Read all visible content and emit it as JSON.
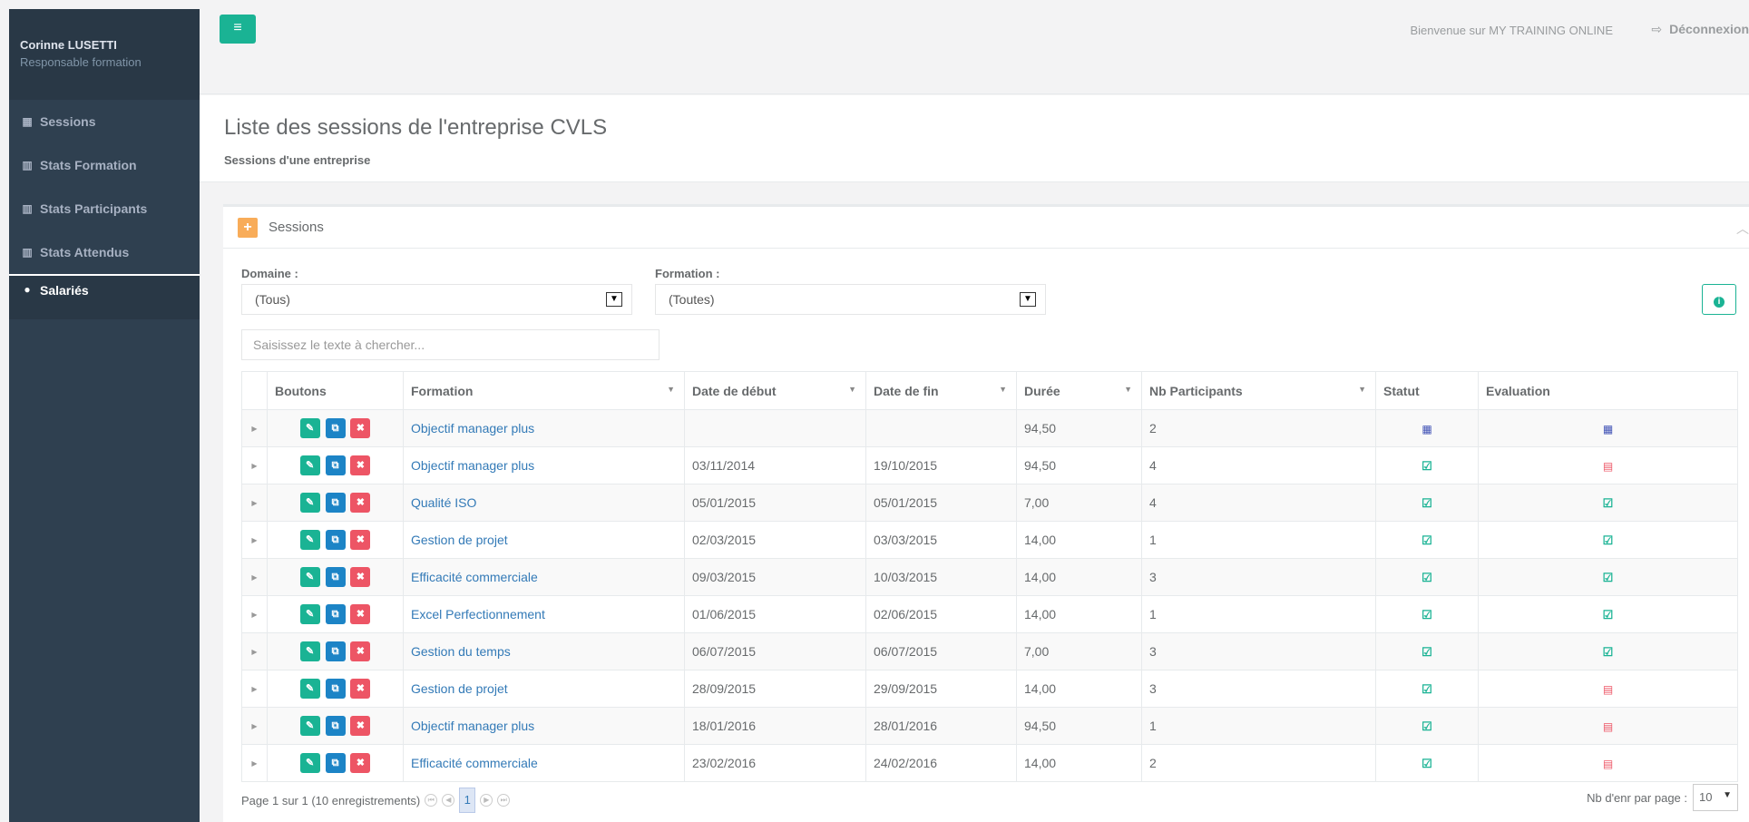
{
  "user": {
    "name": "Corinne LUSETTI",
    "role": "Responsable formation"
  },
  "sidebar": {
    "items": [
      {
        "label": "Sessions",
        "icon": "calendar-icon"
      },
      {
        "label": "Stats Formation",
        "icon": "bar-chart-icon"
      },
      {
        "label": "Stats Participants",
        "icon": "bar-chart-icon"
      },
      {
        "label": "Stats Attendus",
        "icon": "bar-chart-icon"
      },
      {
        "label": "Salariés",
        "icon": "user-icon"
      }
    ]
  },
  "topbar": {
    "welcome": "Bienvenue sur MY TRAINING ONLINE",
    "logout_label": "Déconnexion"
  },
  "heading": {
    "title": "Liste des sessions de l'entreprise CVLS",
    "subtitle": "Sessions d'une entreprise"
  },
  "panel": {
    "title": "Sessions",
    "domaine_label": "Domaine :",
    "domaine_value": "(Tous)",
    "formation_label": "Formation :",
    "formation_value": "(Toutes)",
    "search_placeholder": "Saisissez le texte à chercher..."
  },
  "table": {
    "columns": [
      "Boutons",
      "Formation",
      "Date de début",
      "Date de fin",
      "Durée",
      "Nb Participants",
      "Statut",
      "Evaluation"
    ],
    "rows": [
      {
        "formation": "Objectif manager plus",
        "debut": "",
        "fin": "",
        "duree": "94,50",
        "nb": "2",
        "statut": "calendar",
        "evaluation": "calendar"
      },
      {
        "formation": "Objectif manager plus",
        "debut": "03/11/2014",
        "fin": "19/10/2015",
        "duree": "94,50",
        "nb": "4",
        "statut": "check",
        "evaluation": "doc"
      },
      {
        "formation": "Qualité ISO",
        "debut": "05/01/2015",
        "fin": "05/01/2015",
        "duree": "7,00",
        "nb": "4",
        "statut": "check",
        "evaluation": "check"
      },
      {
        "formation": "Gestion de projet",
        "debut": "02/03/2015",
        "fin": "03/03/2015",
        "duree": "14,00",
        "nb": "1",
        "statut": "check",
        "evaluation": "check"
      },
      {
        "formation": "Efficacité commerciale",
        "debut": "09/03/2015",
        "fin": "10/03/2015",
        "duree": "14,00",
        "nb": "3",
        "statut": "check",
        "evaluation": "check"
      },
      {
        "formation": "Excel Perfectionnement",
        "debut": "01/06/2015",
        "fin": "02/06/2015",
        "duree": "14,00",
        "nb": "1",
        "statut": "check",
        "evaluation": "check"
      },
      {
        "formation": "Gestion du temps",
        "debut": "06/07/2015",
        "fin": "06/07/2015",
        "duree": "7,00",
        "nb": "3",
        "statut": "check",
        "evaluation": "check"
      },
      {
        "formation": "Gestion de projet",
        "debut": "28/09/2015",
        "fin": "29/09/2015",
        "duree": "14,00",
        "nb": "3",
        "statut": "check",
        "evaluation": "doc"
      },
      {
        "formation": "Objectif manager plus",
        "debut": "18/01/2016",
        "fin": "28/01/2016",
        "duree": "94,50",
        "nb": "1",
        "statut": "check",
        "evaluation": "doc"
      },
      {
        "formation": "Efficacité commerciale",
        "debut": "23/02/2016",
        "fin": "24/02/2016",
        "duree": "14,00",
        "nb": "2",
        "statut": "check",
        "evaluation": "doc"
      }
    ]
  },
  "pager": {
    "summary": "Page 1 sur 1 (10 enregistrements)",
    "current_page": "1",
    "per_page_label": "Nb d'enr par page :",
    "per_page_value": "10"
  },
  "colors": {
    "sidebar_bg": "#2f4050",
    "accent_green": "#1ab394",
    "accent_blue": "#1c84c6",
    "accent_red": "#ed5565",
    "accent_orange": "#f8ac59"
  }
}
